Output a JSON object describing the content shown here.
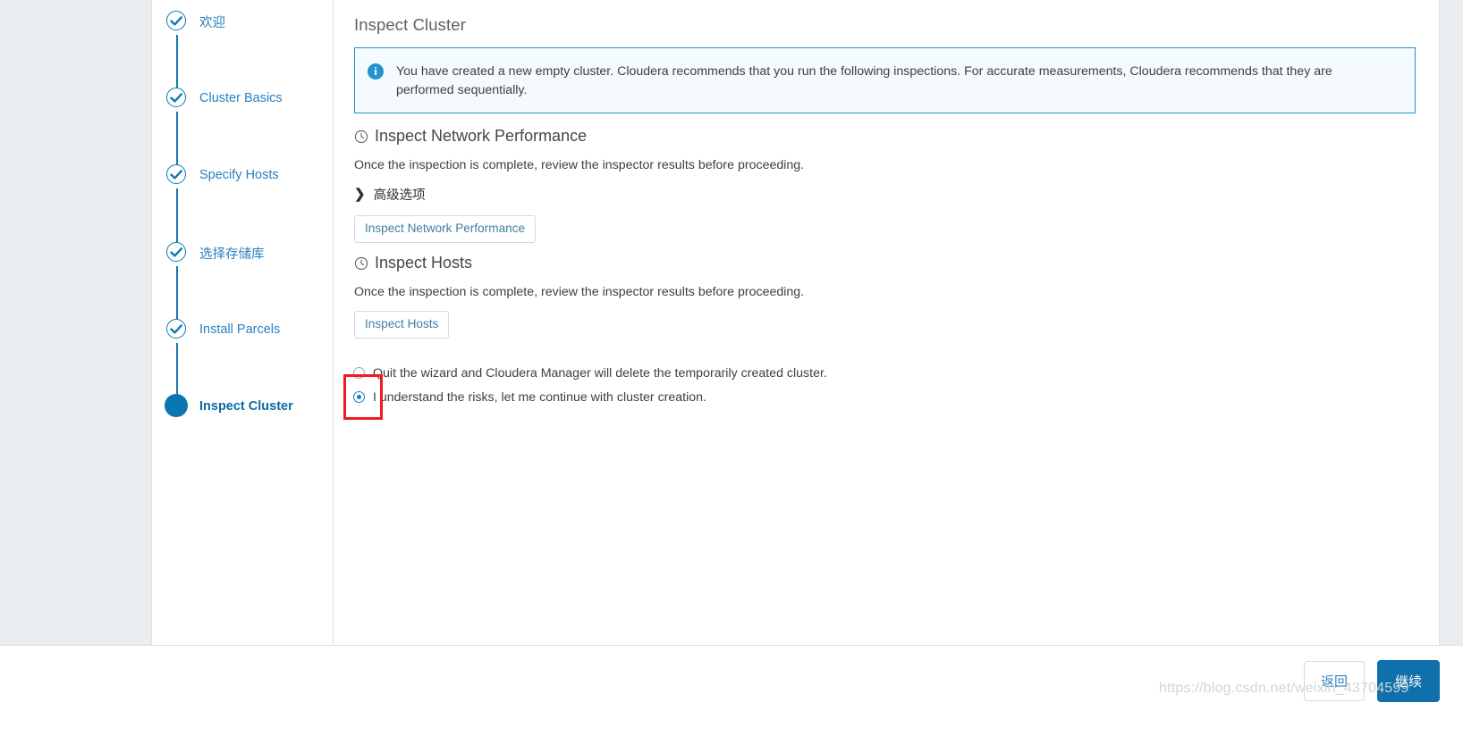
{
  "page": {
    "title": "Inspect Cluster"
  },
  "sidebar": {
    "steps": [
      {
        "label": "欢迎",
        "state": "complete",
        "icon": "check-icon"
      },
      {
        "label": "Cluster Basics",
        "state": "complete",
        "icon": "check-icon"
      },
      {
        "label": "Specify Hosts",
        "state": "complete",
        "icon": "check-icon"
      },
      {
        "label": "选择存储库",
        "state": "complete",
        "icon": "check-icon"
      },
      {
        "label": "Install Parcels",
        "state": "complete",
        "icon": "check-icon"
      },
      {
        "label": "Inspect Cluster",
        "state": "active",
        "icon": "dot-icon"
      }
    ]
  },
  "banner": {
    "icon": "info-icon",
    "text": "You have created a new empty cluster. Cloudera recommends that you run the following inspections. For accurate measurements, Cloudera recommends that they are performed sequentially."
  },
  "sections": [
    {
      "icon": "clock-icon",
      "heading": "Inspect Network Performance",
      "description": "Once the inspection is complete, review the inspector results before proceeding.",
      "advanced_toggle": {
        "chevron": "chevron-right-icon",
        "label": "高级选项"
      },
      "action_label": "Inspect Network Performance"
    },
    {
      "icon": "clock-icon",
      "heading": "Inspect Hosts",
      "description": "Once the inspection is complete, review the inspector results before proceeding.",
      "action_label": "Inspect Hosts"
    }
  ],
  "radio_group": {
    "options": [
      {
        "label": "Quit the wizard and Cloudera Manager will delete the temporarily created cluster.",
        "checked": false
      },
      {
        "label": "I understand the risks, let me continue with cluster creation.",
        "checked": true
      }
    ]
  },
  "footer": {
    "back_label": "返回",
    "continue_label": "继续"
  },
  "watermark": {
    "text": "https://blog.csdn.net/weixin_43704599"
  },
  "colors": {
    "accent": "#0f70ab",
    "step_link": "#2a7fc0",
    "banner_border": "#2193cd",
    "banner_bg": "#f4fafd",
    "highlight": "#ef1c1c",
    "gutter": "#eaedef"
  }
}
